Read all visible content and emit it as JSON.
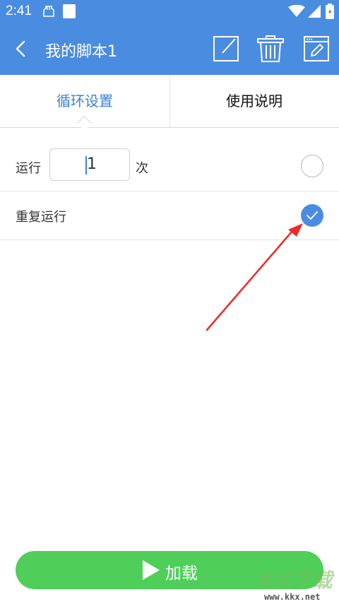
{
  "status_bar": {
    "time": "2:41"
  },
  "app_bar": {
    "title": "我的脚本1"
  },
  "tabs": [
    {
      "label": "循环设置",
      "active": true
    },
    {
      "label": "使用说明",
      "active": false
    }
  ],
  "settings": {
    "run_label": "运行",
    "run_count": "1",
    "run_unit": "次",
    "run_selected": false,
    "repeat_label": "重复运行",
    "repeat_selected": true
  },
  "load_button": {
    "label": "加载"
  },
  "watermark": {
    "brand": "KK下载",
    "url": "www.kkx.net"
  },
  "colors": {
    "primary": "#4a8ce0",
    "accent_text": "#3b82d6",
    "button": "#4fcf5a",
    "annotation_arrow": "#ee2a24"
  }
}
